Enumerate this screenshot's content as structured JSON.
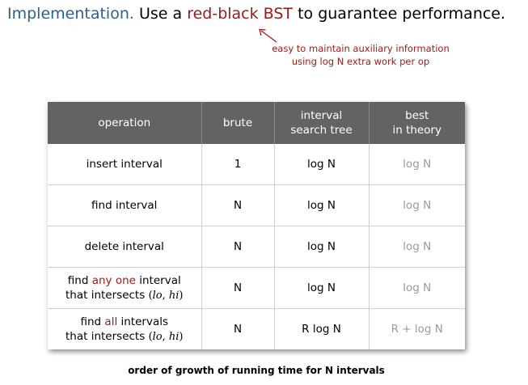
{
  "heading": {
    "lead": "Implementation.",
    "pre": "Use a",
    "highlight": "red-black BST",
    "post": "to guarantee performance."
  },
  "note": {
    "line1": "easy to maintain auxiliary information",
    "line2": "using log N extra work per op"
  },
  "table": {
    "headers": {
      "operation": "operation",
      "brute": "brute",
      "ist_line1": "interval",
      "ist_line2": "search tree",
      "best_line1": "best",
      "best_line2": "in theory"
    },
    "rows": [
      {
        "op": "insert interval",
        "brute": "1",
        "ist": "log N",
        "best": "log N"
      },
      {
        "op": "find interval",
        "brute": "N",
        "ist": "log N",
        "best": "log N"
      },
      {
        "op": "delete interval",
        "brute": "N",
        "ist": "log N",
        "best": "log N"
      },
      {
        "op_pre": "find",
        "op_accent": "any one",
        "op_post": "interval",
        "op_line2": "that intersects",
        "brute": "N",
        "ist": "log N",
        "best": "log N"
      },
      {
        "op_pre": "find",
        "op_accent": "all",
        "op_post": "intervals",
        "op_line2": "that intersects",
        "brute": "N",
        "ist": "R log N",
        "best": "R + log N"
      }
    ],
    "interval_open": "(",
    "interval_lo": "lo",
    "interval_sep": ", ",
    "interval_hi": "hi",
    "interval_close": ")"
  },
  "caption": "order of growth of running time for N intervals",
  "colors": {
    "lead": "#2e5e8c",
    "accent": "#9a1a1a",
    "header_bg": "#636363",
    "theory_text": "#9a9a9a"
  }
}
